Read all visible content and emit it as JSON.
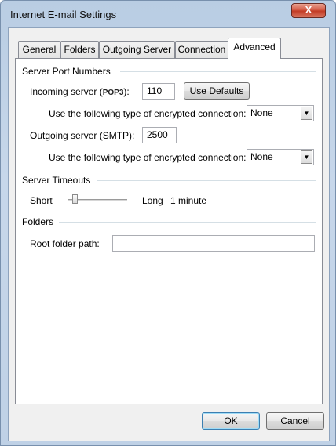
{
  "window": {
    "title": "Internet E-mail Settings",
    "close_label": "X"
  },
  "tabs": [
    {
      "label": "General"
    },
    {
      "label": "Folders"
    },
    {
      "label": "Outgoing Server"
    },
    {
      "label": "Connection"
    },
    {
      "label": "Advanced"
    }
  ],
  "active_tab": "Advanced",
  "server_ports": {
    "group_label": "Server Port Numbers",
    "incoming_prefix": "Incoming server (",
    "incoming_protocol": "POP3",
    "incoming_suffix": "):",
    "incoming_value": "110",
    "use_defaults_label": "Use Defaults",
    "encryption_label_1": "Use the following type of encrypted connection:",
    "encryption_value_1": "None",
    "outgoing_label": "Outgoing server (SMTP):",
    "outgoing_value": "2500",
    "encryption_label_2": "Use the following type of encrypted connection:",
    "encryption_value_2": "None"
  },
  "timeouts": {
    "group_label": "Server Timeouts",
    "short_label": "Short",
    "long_label": "Long",
    "value_label": "1 minute",
    "slider_position": 0.12
  },
  "folders": {
    "group_label": "Folders",
    "root_label": "Root folder path:",
    "root_value": ""
  },
  "buttons": {
    "ok_label": "OK",
    "cancel_label": "Cancel"
  },
  "colors": {
    "title_bar": "#b9cde3",
    "close_button": "#c13a23",
    "dialog_face": "#f0f0f0"
  }
}
